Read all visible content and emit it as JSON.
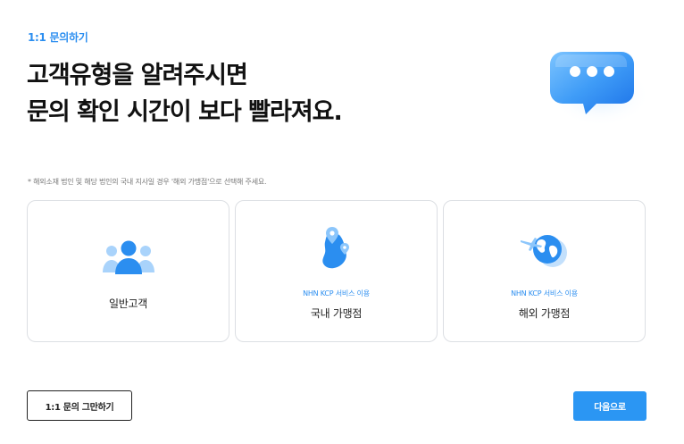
{
  "header": {
    "eyebrow": "1:1 문의하기",
    "headline_line1": "고객유형을 알려주시면",
    "headline_line2": "문의 확인 시간이 보다 빨라져요."
  },
  "notice": "* 해외소재 법인 및 해당 법인의 국내 지사일 경우 '해외 가맹점'으로 선택해 주세요.",
  "options": [
    {
      "label": "일반고객",
      "sub": "",
      "icon": "people-icon"
    },
    {
      "label": "국내 가맹점",
      "sub": "NHN KCP 서비스 이용",
      "icon": "korea-map-pin-icon"
    },
    {
      "label": "해외 가맹점",
      "sub": "NHN KCP 서비스 이용",
      "icon": "globe-plane-icon"
    }
  ],
  "buttons": {
    "quit": "1:1 문의 그만하기",
    "next": "다음으로"
  },
  "colors": {
    "accent": "#2b96f3",
    "heading": "#111111",
    "border": "#dcdfe3"
  }
}
